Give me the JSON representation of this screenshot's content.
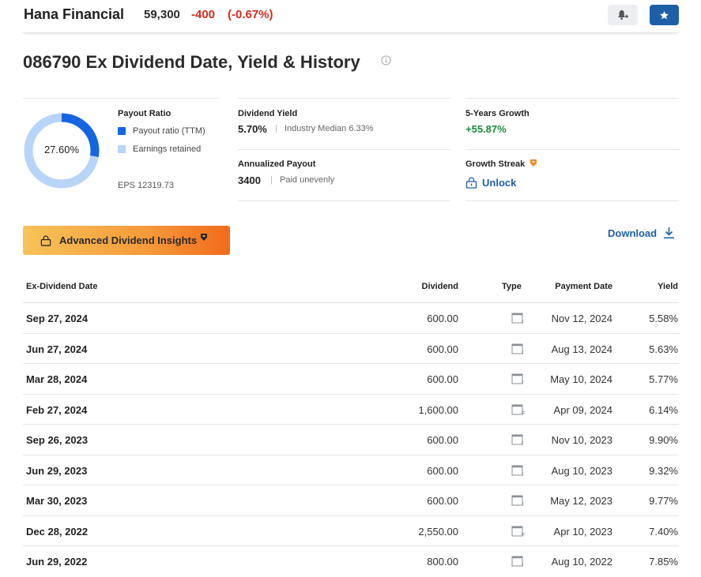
{
  "header": {
    "company": "Hana Financial",
    "price": "59,300",
    "change": "-400",
    "change_pct": "(-0.67%)"
  },
  "icons": {
    "alert": "bell-plus-icon",
    "watchlist": "star-icon",
    "info": "info-icon",
    "lock": "lock-icon",
    "download": "download-icon",
    "premium": "premium-badge-icon",
    "calendar": "calendar-icon"
  },
  "page_title": "086790 Ex Dividend Date, Yield & History",
  "payout": {
    "title": "Payout Ratio",
    "value_label": "27.60%",
    "ratio_fraction": 0.276,
    "legend_ttm": "Payout ratio (TTM)",
    "legend_retained": "Earnings retained",
    "eps": "EPS 12319.73",
    "color_ttm": "#1565e0",
    "color_retained": "#b8d4f8"
  },
  "dividend_yield": {
    "label": "Dividend Yield",
    "value": "5.70%",
    "sub": "Industry Median 6.33%"
  },
  "annualized_payout": {
    "label": "Annualized Payout",
    "value": "3400",
    "sub": "Paid unevenly"
  },
  "five_year_growth": {
    "label": "5-Years Growth",
    "value": "+55.87%"
  },
  "growth_streak": {
    "label": "Growth Streak",
    "unlock": "Unlock"
  },
  "insights_button": "Advanced Dividend Insights",
  "download_label": "Download",
  "table": {
    "headers": {
      "ex_date": "Ex-Dividend Date",
      "dividend": "Dividend",
      "type": "Type",
      "payment": "Payment Date",
      "yield": "Yield"
    },
    "rows": [
      {
        "ex_date": "Sep 27, 2024",
        "dividend": "600.00",
        "type": "I",
        "payment": "Nov 12, 2024",
        "yield": "5.58%"
      },
      {
        "ex_date": "Jun 27, 2024",
        "dividend": "600.00",
        "type": "I",
        "payment": "Aug 13, 2024",
        "yield": "5.63%"
      },
      {
        "ex_date": "Mar 28, 2024",
        "dividend": "600.00",
        "type": "I",
        "payment": "May 10, 2024",
        "yield": "5.77%"
      },
      {
        "ex_date": "Feb 27, 2024",
        "dividend": "1,600.00",
        "type": "F",
        "payment": "Apr 09, 2024",
        "yield": "6.14%"
      },
      {
        "ex_date": "Sep 26, 2023",
        "dividend": "600.00",
        "type": "I",
        "payment": "Nov 10, 2023",
        "yield": "9.90%"
      },
      {
        "ex_date": "Jun 29, 2023",
        "dividend": "600.00",
        "type": "I",
        "payment": "Aug 10, 2023",
        "yield": "9.32%"
      },
      {
        "ex_date": "Mar 30, 2023",
        "dividend": "600.00",
        "type": "I",
        "payment": "May 12, 2023",
        "yield": "9.77%"
      },
      {
        "ex_date": "Dec 28, 2022",
        "dividend": "2,550.00",
        "type": "F",
        "payment": "Apr 10, 2023",
        "yield": "7.40%"
      },
      {
        "ex_date": "Jun 29, 2022",
        "dividend": "800.00",
        "type": "I",
        "payment": "Aug 10, 2022",
        "yield": "7.85%"
      }
    ]
  }
}
